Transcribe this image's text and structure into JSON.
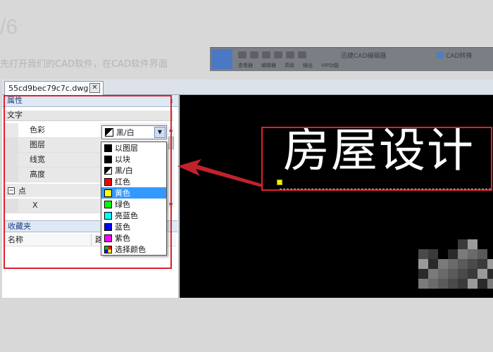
{
  "background": {
    "step": "/6",
    "instruction": "先打开我们的CAD软件，在CAD软件界面"
  },
  "mini_window": {
    "title": "迅捷CAD编辑器",
    "convert": "CAD转换",
    "menu": [
      "查看器",
      "编辑器",
      "高级",
      "输出",
      "VIP功能"
    ]
  },
  "document_tab": {
    "filename": "55cd9bec79c7c.dwg",
    "close_glyph": "✕"
  },
  "properties_panel": {
    "title": "属性",
    "pin_glyph": "⇕",
    "category": "文字",
    "rows": [
      {
        "name": "色彩"
      },
      {
        "name": "图层"
      },
      {
        "name": "线宽"
      },
      {
        "name": "高度"
      }
    ],
    "point_section": {
      "toggle": "−",
      "label": "点"
    },
    "x_row": {
      "name": "X"
    }
  },
  "color_combo": {
    "value": "黑/白",
    "arrow": "▼"
  },
  "color_options": [
    {
      "label": "以图层",
      "color": "#000000"
    },
    {
      "label": "以块",
      "color": "#000000"
    },
    {
      "label": "黑/白",
      "color": "bw"
    },
    {
      "label": "红色",
      "color": "#ff0000"
    },
    {
      "label": "黄色",
      "color": "#ffff00",
      "selected": true
    },
    {
      "label": "绿色",
      "color": "#00ff00"
    },
    {
      "label": "亮蓝色",
      "color": "#00ffff"
    },
    {
      "label": "蓝色",
      "color": "#0000ff"
    },
    {
      "label": "紫色",
      "color": "#ff00ff"
    },
    {
      "label": "选择颜色",
      "color": "multi"
    }
  ],
  "favorites": {
    "title": "收藏夹",
    "col_name": "名称",
    "col_path": "路"
  },
  "canvas": {
    "text": "房屋设计"
  },
  "colors": {
    "annotation": "#e0202e",
    "selected_bg": "#3399ff",
    "canvas_bg": "#000000"
  }
}
